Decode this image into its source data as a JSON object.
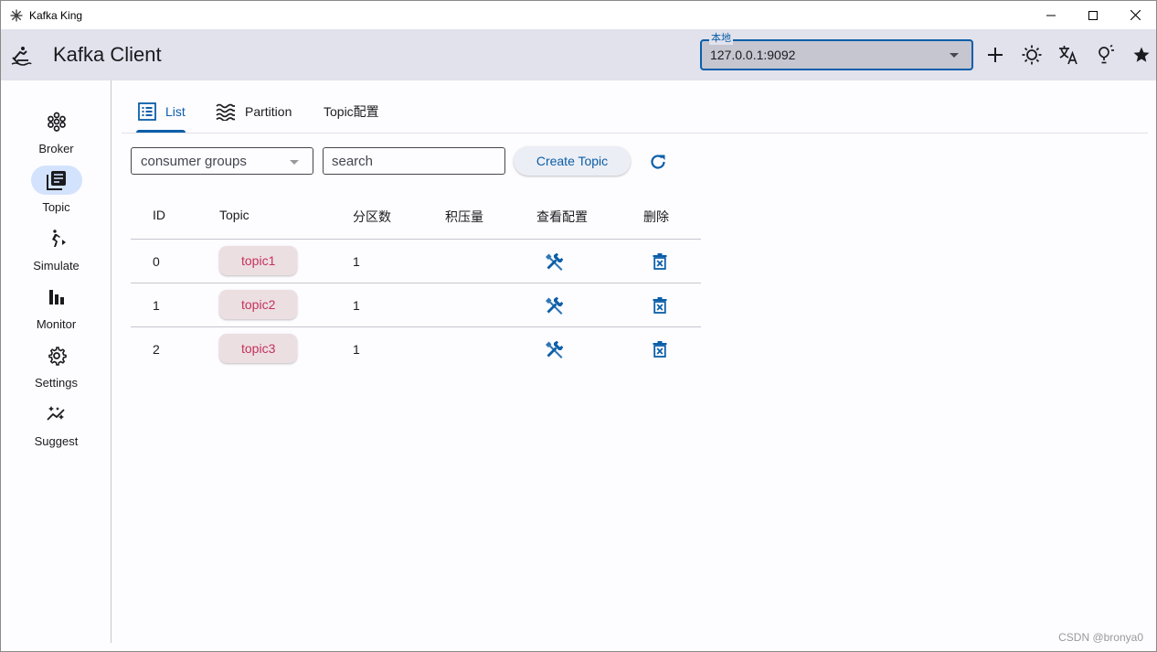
{
  "window": {
    "title": "Kafka King",
    "controls": [
      "minimize",
      "maximize",
      "close"
    ]
  },
  "appbar": {
    "title": "Kafka Client",
    "server_select": {
      "label": "本地",
      "value": "127.0.0.1:9092"
    },
    "actions": [
      {
        "name": "add-icon"
      },
      {
        "name": "theme-icon"
      },
      {
        "name": "translate-icon"
      },
      {
        "name": "lightbulb-icon"
      },
      {
        "name": "star-icon"
      }
    ]
  },
  "nav": {
    "items": [
      {
        "label": "Broker",
        "icon": "broker-icon",
        "active": false
      },
      {
        "label": "Topic",
        "icon": "topic-icon",
        "active": true
      },
      {
        "label": "Simulate",
        "icon": "simulate-icon",
        "active": false
      },
      {
        "label": "Monitor",
        "icon": "monitor-icon",
        "active": false
      },
      {
        "label": "Settings",
        "icon": "settings-icon",
        "active": false
      },
      {
        "label": "Suggest",
        "icon": "suggest-icon",
        "active": false
      }
    ]
  },
  "tabs": [
    {
      "label": "List",
      "icon": "list-icon",
      "active": true
    },
    {
      "label": "Partition",
      "icon": "waves-icon",
      "active": false
    },
    {
      "label": "Topic配置",
      "active": false
    }
  ],
  "toolbar": {
    "group_select": "consumer groups",
    "search_placeholder": "search",
    "create_label": "Create Topic"
  },
  "table": {
    "headers": [
      "ID",
      "Topic",
      "分区数",
      "积压量",
      "查看配置",
      "删除"
    ],
    "rows": [
      {
        "id": "0",
        "topic": "topic1",
        "partitions": "1",
        "backlog": ""
      },
      {
        "id": "1",
        "topic": "topic2",
        "partitions": "1",
        "backlog": ""
      },
      {
        "id": "2",
        "topic": "topic3",
        "partitions": "1",
        "backlog": ""
      }
    ]
  },
  "watermark": "CSDN @bronya0",
  "colors": {
    "primary": "#0a5ea8",
    "appbar_bg": "#e1e2ec",
    "chip_text": "#c4325c",
    "chip_bg": "#ecdfe2",
    "nav_active": "#d3e3fd"
  }
}
